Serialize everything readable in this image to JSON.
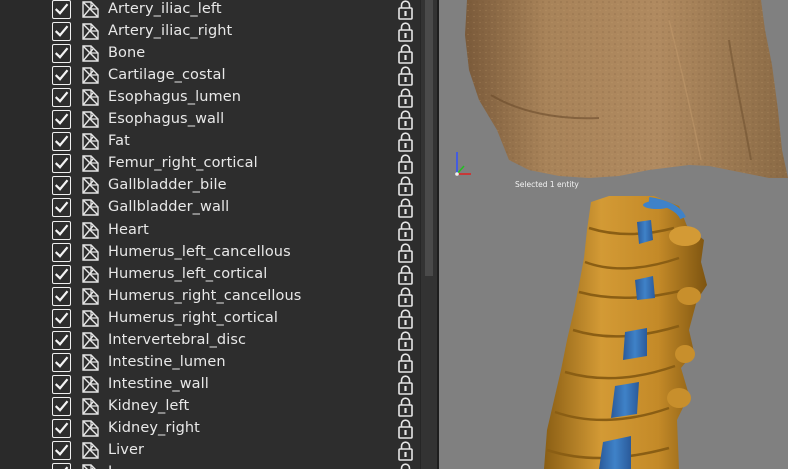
{
  "segments": [
    {
      "label": "Artery_iliac_left",
      "checked": true
    },
    {
      "label": "Artery_iliac_right",
      "checked": true
    },
    {
      "label": "Bone",
      "checked": true
    },
    {
      "label": "Cartilage_costal",
      "checked": true
    },
    {
      "label": "Esophagus_lumen",
      "checked": true
    },
    {
      "label": "Esophagus_wall",
      "checked": true
    },
    {
      "label": "Fat",
      "checked": true
    },
    {
      "label": "Femur_right_cortical",
      "checked": true
    },
    {
      "label": "Gallbladder_bile",
      "checked": true
    },
    {
      "label": "Gallbladder_wall",
      "checked": true
    },
    {
      "label": "Heart",
      "checked": true
    },
    {
      "label": "Humerus_left_cancellous",
      "checked": true
    },
    {
      "label": "Humerus_left_cortical",
      "checked": true
    },
    {
      "label": "Humerus_right_cancellous",
      "checked": true
    },
    {
      "label": "Humerus_right_cortical",
      "checked": true
    },
    {
      "label": "Intervertebral_disc",
      "checked": true
    },
    {
      "label": "Intestine_lumen",
      "checked": true
    },
    {
      "label": "Intestine_wall",
      "checked": true
    },
    {
      "label": "Kidney_left",
      "checked": true
    },
    {
      "label": "Kidney_right",
      "checked": true
    },
    {
      "label": "Liver",
      "checked": true
    },
    {
      "label": "L",
      "checked": true
    }
  ],
  "viewport": {
    "status": "Selected 1 entity"
  },
  "colors": {
    "panel_bg": "#2d2d2d",
    "viewport_bg": "#808080",
    "bone": "#c8922e",
    "disc": "#3a78c0",
    "skin": "#a57f55"
  }
}
